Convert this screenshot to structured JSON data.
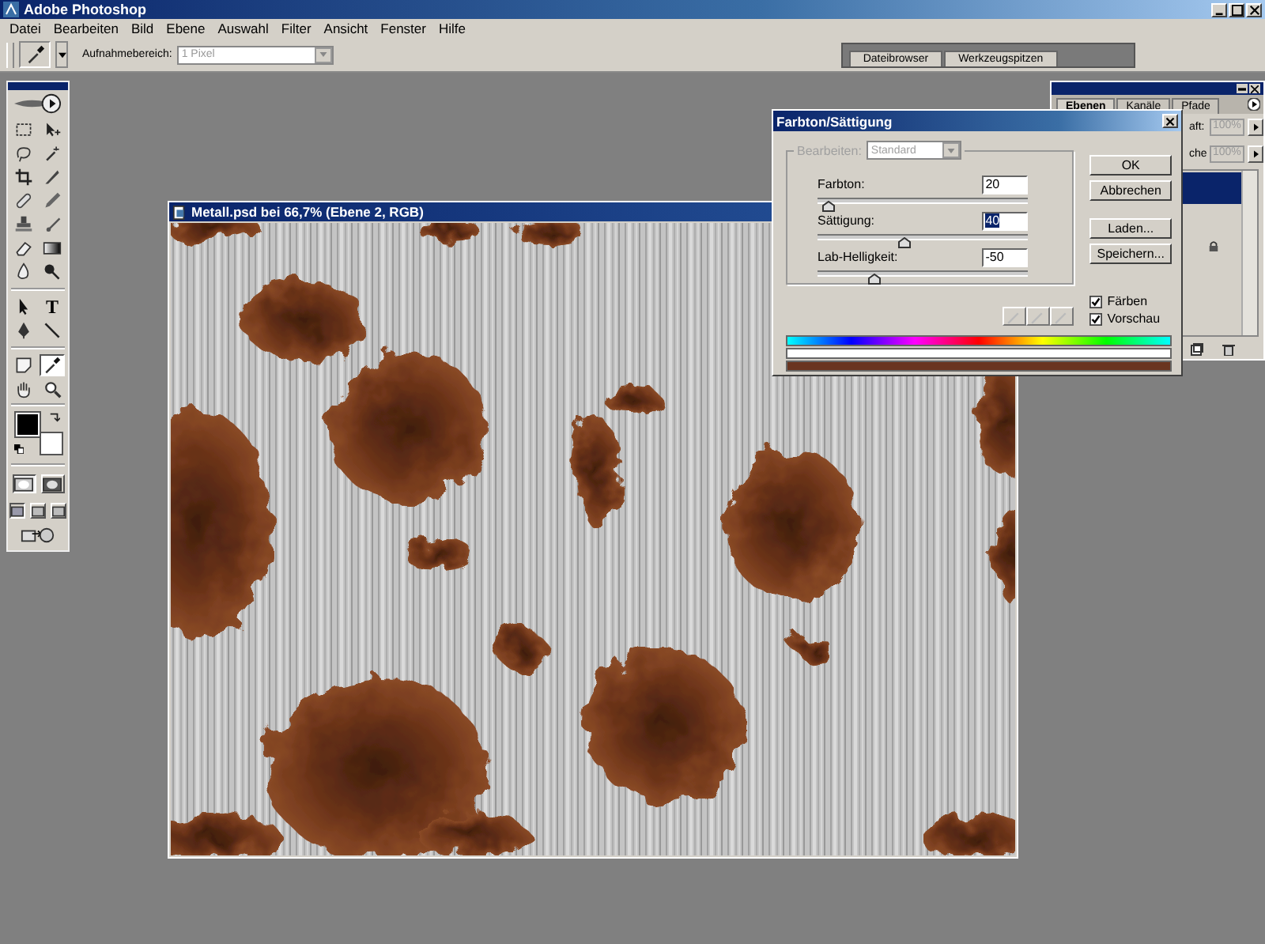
{
  "app": {
    "title": "Adobe Photoshop"
  },
  "menu": [
    "Datei",
    "Bearbeiten",
    "Bild",
    "Ebene",
    "Auswahl",
    "Filter",
    "Ansicht",
    "Fenster",
    "Hilfe"
  ],
  "options_bar": {
    "sample_label": "Aufnahmebereich:",
    "sample_value": "1 Pixel"
  },
  "palette_well": [
    {
      "label": "Dateibrowser"
    },
    {
      "label": "Werkzeugspitzen"
    }
  ],
  "toolbox": {
    "tools": [
      {
        "selected": false
      },
      {
        "selected": false
      },
      {
        "selected": false
      },
      {
        "selected": false
      },
      {
        "selected": false
      },
      {
        "selected": false
      },
      {
        "selected": false
      },
      {
        "selected": false
      },
      {
        "selected": false
      },
      {
        "selected": false
      },
      {
        "selected": false
      },
      {
        "selected": false
      },
      {
        "selected": false
      },
      {
        "selected": false
      },
      {
        "selected": false
      },
      {
        "label": "T",
        "selected": false
      },
      {
        "selected": false
      },
      {
        "selected": false
      },
      {
        "selected": false
      },
      {
        "selected": true
      },
      {
        "selected": false
      },
      {
        "selected": false
      }
    ],
    "quick_mask": [
      {
        "selected": true
      },
      {
        "selected": false
      }
    ],
    "screen_modes": [
      {
        "selected": true
      },
      {
        "selected": false
      },
      {
        "selected": false
      }
    ]
  },
  "document": {
    "title": "Metall.psd bei 66,7% (Ebene 2, RGB)"
  },
  "layers_panel": {
    "tabs": [
      {
        "label": "Ebenen",
        "selected": true
      },
      {
        "label": "Kanäle",
        "selected": false
      },
      {
        "label": "Pfade",
        "selected": false
      }
    ],
    "opacity_label": "aft:",
    "opacity_value": "100%",
    "fill_label": "che",
    "fill_value": "100%"
  },
  "dialog": {
    "title": "Farbton/Sättigung",
    "edit_label": "Bearbeiten:",
    "edit_value": "Standard",
    "edit_disabled": true,
    "sliders": [
      {
        "label": "Farbton:",
        "value": "20",
        "level": 0.03,
        "selected": false
      },
      {
        "label": "Sättigung:",
        "value": "40",
        "level": 0.39,
        "selected": true
      },
      {
        "label": "Lab-Helligkeit:",
        "value": "-50",
        "level": 0.25,
        "selected": false
      }
    ],
    "buttons": [
      "OK",
      "Abbrechen",
      "Laden...",
      "Speichern..."
    ],
    "checkboxes": [
      {
        "label": "Färben",
        "checked": true
      },
      {
        "label": "Vorschau",
        "checked": true
      }
    ]
  }
}
